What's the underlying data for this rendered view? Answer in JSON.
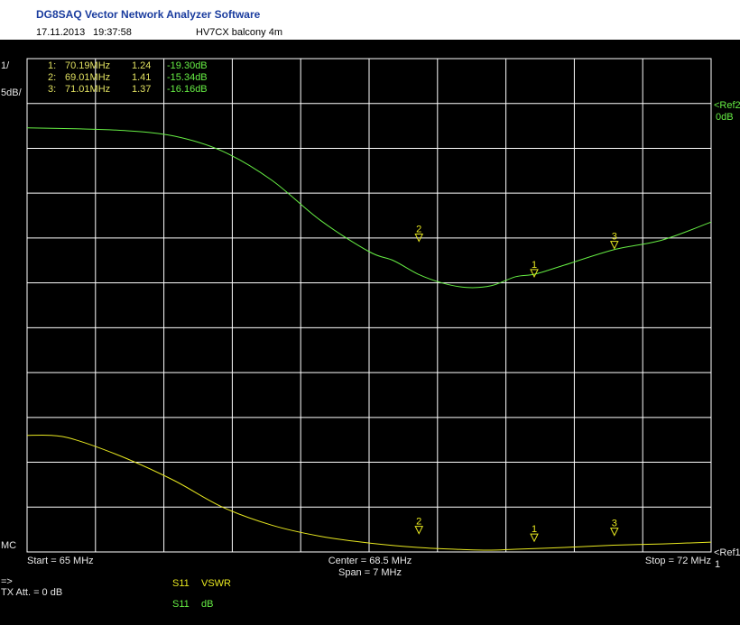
{
  "header": {
    "title": "DG8SAQ Vector Network Analyzer Software",
    "date": "17.11.2013",
    "time": "19:37:58",
    "note": "HV7CX balcony 4m"
  },
  "scale": {
    "line1": "1/",
    "line2": "5dB/"
  },
  "markers_table": [
    {
      "idx": "1:",
      "freq": "70.19MHz",
      "vswr": "1.24",
      "db": "-19.30dB"
    },
    {
      "idx": "2:",
      "freq": "69.01MHz",
      "vswr": "1.41",
      "db": "-15.34dB"
    },
    {
      "idx": "3:",
      "freq": "71.01MHz",
      "vswr": "1.37",
      "db": "-16.16dB"
    }
  ],
  "ref_labels": {
    "ref2": "<Ref2",
    "ref2_val": "0dB",
    "ref1": "<Ref1",
    "ref1_val": "1",
    "mc": "MC"
  },
  "freq_axis": {
    "start": "Start = 65 MHz",
    "center": "Center = 68.5 MHz",
    "span": "Span = 7 MHz",
    "stop": "Stop = 72 MHz"
  },
  "bottom": {
    "arrow": "=>",
    "tx_att": "TX Att.  = 0 dB",
    "trace1_param": "S11",
    "trace1_fmt": "VSWR",
    "trace2_param": "S11",
    "trace2_fmt": "dB"
  },
  "colors": {
    "s11_db": "#66ee44",
    "s11_vswr": "#e8e820",
    "grid": "#ffffff",
    "background": "#000000"
  },
  "chart_data": {
    "type": "line",
    "xlim": [
      65,
      72
    ],
    "grid": true,
    "series": [
      {
        "name": "S11 dB",
        "ylim": [
          -50,
          0
        ],
        "x": [
          65,
          65.5,
          66,
          66.5,
          67,
          67.5,
          68,
          68.5,
          68.75,
          69,
          69.25,
          69.5,
          69.75,
          70,
          70.2,
          70.5,
          71,
          71.5,
          72
        ],
        "y": [
          -2.7,
          -2.8,
          -3.0,
          -3.6,
          -5.3,
          -8.5,
          -13.0,
          -16.5,
          -17.5,
          -19.0,
          -20.0,
          -20.5,
          -20.3,
          -19.3,
          -19.0,
          -18.0,
          -16.3,
          -15.2,
          -13.2
        ]
      },
      {
        "name": "S11 VSWR",
        "ylim": [
          1,
          6
        ],
        "x": [
          65,
          65.25,
          65.5,
          66,
          66.5,
          67,
          67.5,
          68,
          68.5,
          69,
          69.5,
          69.75,
          70,
          70.5,
          71,
          71.5,
          72
        ],
        "y": [
          3.6,
          3.6,
          3.5,
          3.1,
          2.6,
          2.0,
          1.6,
          1.35,
          1.2,
          1.1,
          1.05,
          1.04,
          1.06,
          1.1,
          1.15,
          1.18,
          1.22
        ]
      }
    ],
    "markers": [
      {
        "label": "1",
        "x": 70.19,
        "db": -19.3,
        "vswr": 1.24
      },
      {
        "label": "2",
        "x": 69.01,
        "db": -15.34,
        "vswr": 1.41
      },
      {
        "label": "3",
        "x": 71.01,
        "db": -16.16,
        "vswr": 1.37
      }
    ]
  }
}
